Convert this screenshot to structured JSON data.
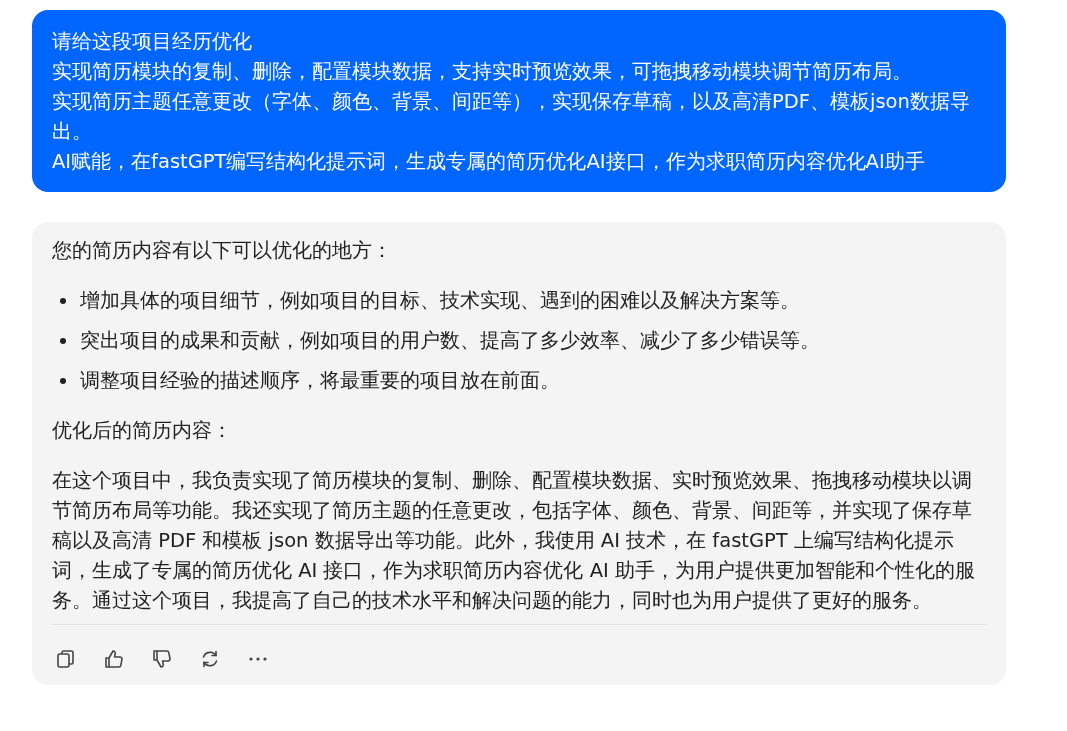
{
  "user_message": {
    "lines": [
      "请给这段项目经历优化",
      "实现简历模块的复制、删除，配置模块数据，支持实时预览效果，可拖拽移动模块调节简历布局。",
      "实现简历主题任意更改（字体、颜色、背景、间距等），实现保存草稿，以及高清PDF、模板json数据导出。",
      "AI赋能，在fastGPT编写结构化提示词，生成专属的简历优化AI接口，作为求职简历内容优化AI助手"
    ]
  },
  "reply": {
    "intro": "您的简历内容有以下可以优化的地方：",
    "suggestions": [
      "增加具体的项目细节，例如项目的目标、技术实现、遇到的困难以及解决方案等。",
      "突出项目的成果和贡献，例如项目的用户数、提高了多少效率、减少了多少错误等。",
      "调整项目经验的描述顺序，将最重要的项目放在前面。"
    ],
    "heading": "优化后的简历内容：",
    "body": "在这个项目中，我负责实现了简历模块的复制、删除、配置模块数据、实时预览效果、拖拽移动模块以调节简历布局等功能。我还实现了简历主题的任意更改，包括字体、颜色、背景、间距等，并实现了保存草稿以及高清 PDF 和模板 json 数据导出等功能。此外，我使用 AI 技术，在 fastGPT 上编写结构化提示词，生成了专属的简历优化 AI 接口，作为求职简历内容优化 AI 助手，为用户提供更加智能和个性化的服务。通过这个项目，我提高了自己的技术水平和解决问题的能力，同时也为用户提供了更好的服务。",
    "actions": [
      {
        "kind": "copy"
      },
      {
        "kind": "like"
      },
      {
        "kind": "dislike"
      },
      {
        "kind": "regenerate"
      },
      {
        "kind": "more"
      }
    ]
  }
}
